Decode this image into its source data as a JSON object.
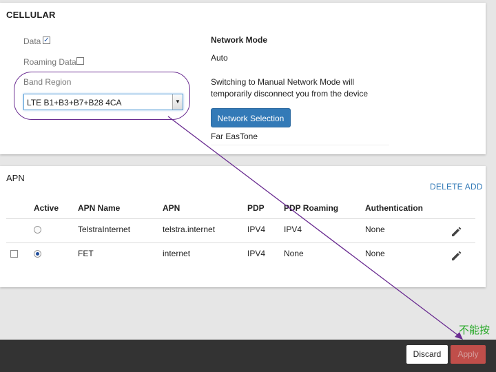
{
  "cellular": {
    "title": "CELLULAR",
    "data_label": "Data",
    "data_checked": true,
    "roaming_label": "Roaming Data",
    "roaming_checked": false,
    "band_region_label": "Band Region",
    "band_region_value": "LTE B1+B3+B7+B28 4CA",
    "network_mode_title": "Network Mode",
    "network_mode_value": "Auto",
    "switch_note_line1": "Switching to Manual Network Mode will",
    "switch_note_line2": "temporarily disconnect you from the device",
    "network_selection_label": "Network Selection",
    "operator": "Far EasTone"
  },
  "apn": {
    "title": "APN",
    "delete_label": "DELETE",
    "add_label": "ADD",
    "columns": [
      "Active",
      "APN Name",
      "APN",
      "PDP",
      "PDP Roaming",
      "Authentication"
    ],
    "rows": [
      {
        "selected": false,
        "active": false,
        "name": "TelstraInternet",
        "apn": "telstra.internet",
        "pdp": "IPV4",
        "pdp_roaming": "IPV4",
        "auth": "None"
      },
      {
        "selected": false,
        "active": true,
        "name": "FET",
        "apn": "internet",
        "pdp": "IPV4",
        "pdp_roaming": "None",
        "auth": "None"
      }
    ]
  },
  "footer": {
    "discard_label": "Discard",
    "apply_label": "Apply"
  },
  "annotation": {
    "note": "不能按",
    "line_color": "#6a2c91",
    "note_color": "#25a825"
  },
  "icons": [
    "checkbox-checked",
    "checkbox-unchecked",
    "dropdown-arrow",
    "radio",
    "pencil-icon"
  ]
}
